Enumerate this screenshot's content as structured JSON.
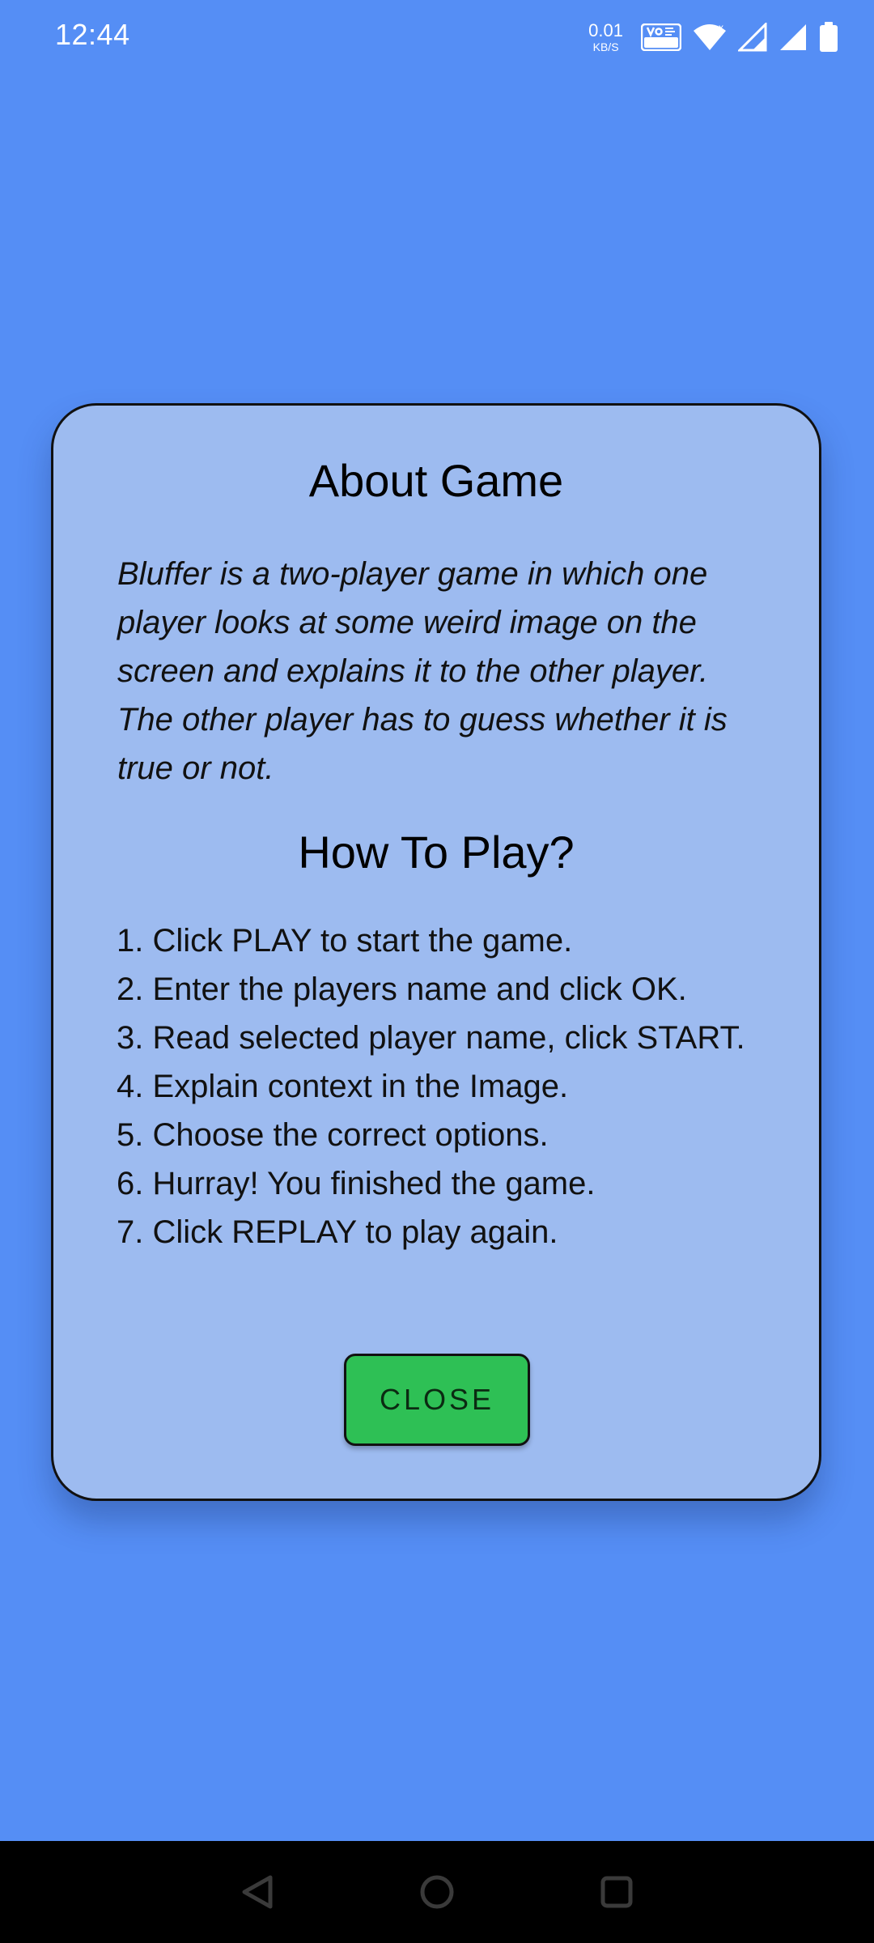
{
  "status_bar": {
    "time": "12:44",
    "net_speed_value": "0.01",
    "net_speed_unit": "KB/S",
    "icons": [
      "vowifi-icon",
      "wifi-icon",
      "cell-signal-icon",
      "cell-signal-icon",
      "battery-icon"
    ]
  },
  "dialog": {
    "title": "About Game",
    "description": "Bluffer is a two-player game in which one player looks at some weird image on the screen and explains it to the other player. The other player has to guess whether it is true or not.",
    "howto_title": "How To Play?",
    "steps": [
      "1. Click PLAY to start the game.",
      "2. Enter the players name and click OK.",
      "3. Read selected player name, click START.",
      "4. Explain context in the Image.",
      "5. Choose the correct options.",
      "6. Hurray! You finished the game.",
      "7. Click REPLAY to play again."
    ],
    "close_label": "CLOSE"
  },
  "nav_bar": {
    "icons": [
      "back-icon",
      "home-icon",
      "recents-icon"
    ]
  },
  "colors": {
    "background": "#558ef5",
    "dialog": "#9dbbf0",
    "close_button": "#2ec055"
  }
}
